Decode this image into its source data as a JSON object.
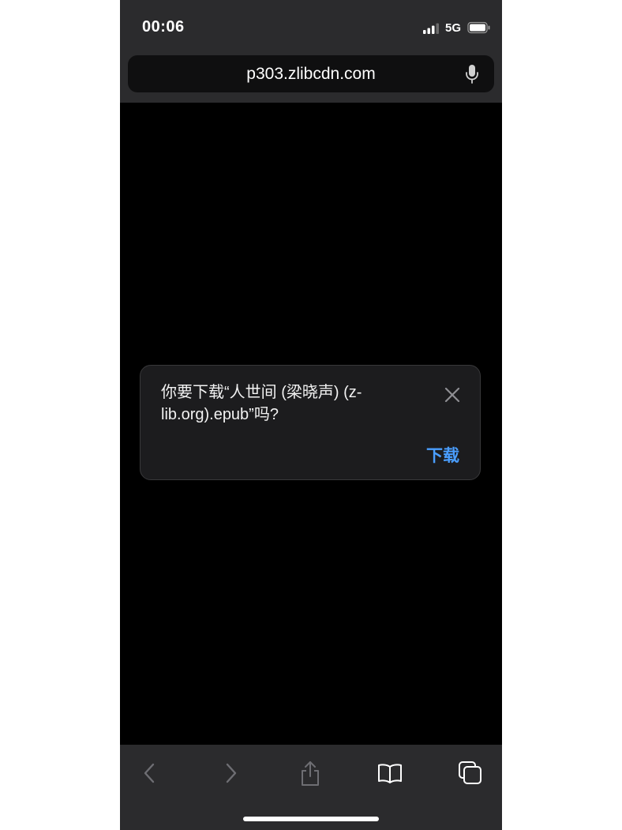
{
  "status_bar": {
    "time": "00:06",
    "network": "5G",
    "icons": [
      "signal-icon",
      "battery-icon"
    ]
  },
  "address_bar": {
    "url": "p303.zlibcdn.com",
    "icon": "microphone-icon"
  },
  "download_dialog": {
    "message": "你要下载“人世间 (梁晓声) (z-lib.org).epub”吗?",
    "download_label": "下载",
    "close_icon": "close-icon",
    "accent_color": "#4a9eff"
  },
  "toolbar": {
    "icons": [
      "back-icon",
      "forward-icon",
      "share-icon",
      "bookmarks-icon",
      "tabs-icon"
    ]
  },
  "colors": {
    "chrome_background": "#2b2b2d",
    "page_background": "#000000",
    "dialog_background": "#1c1c1e"
  }
}
